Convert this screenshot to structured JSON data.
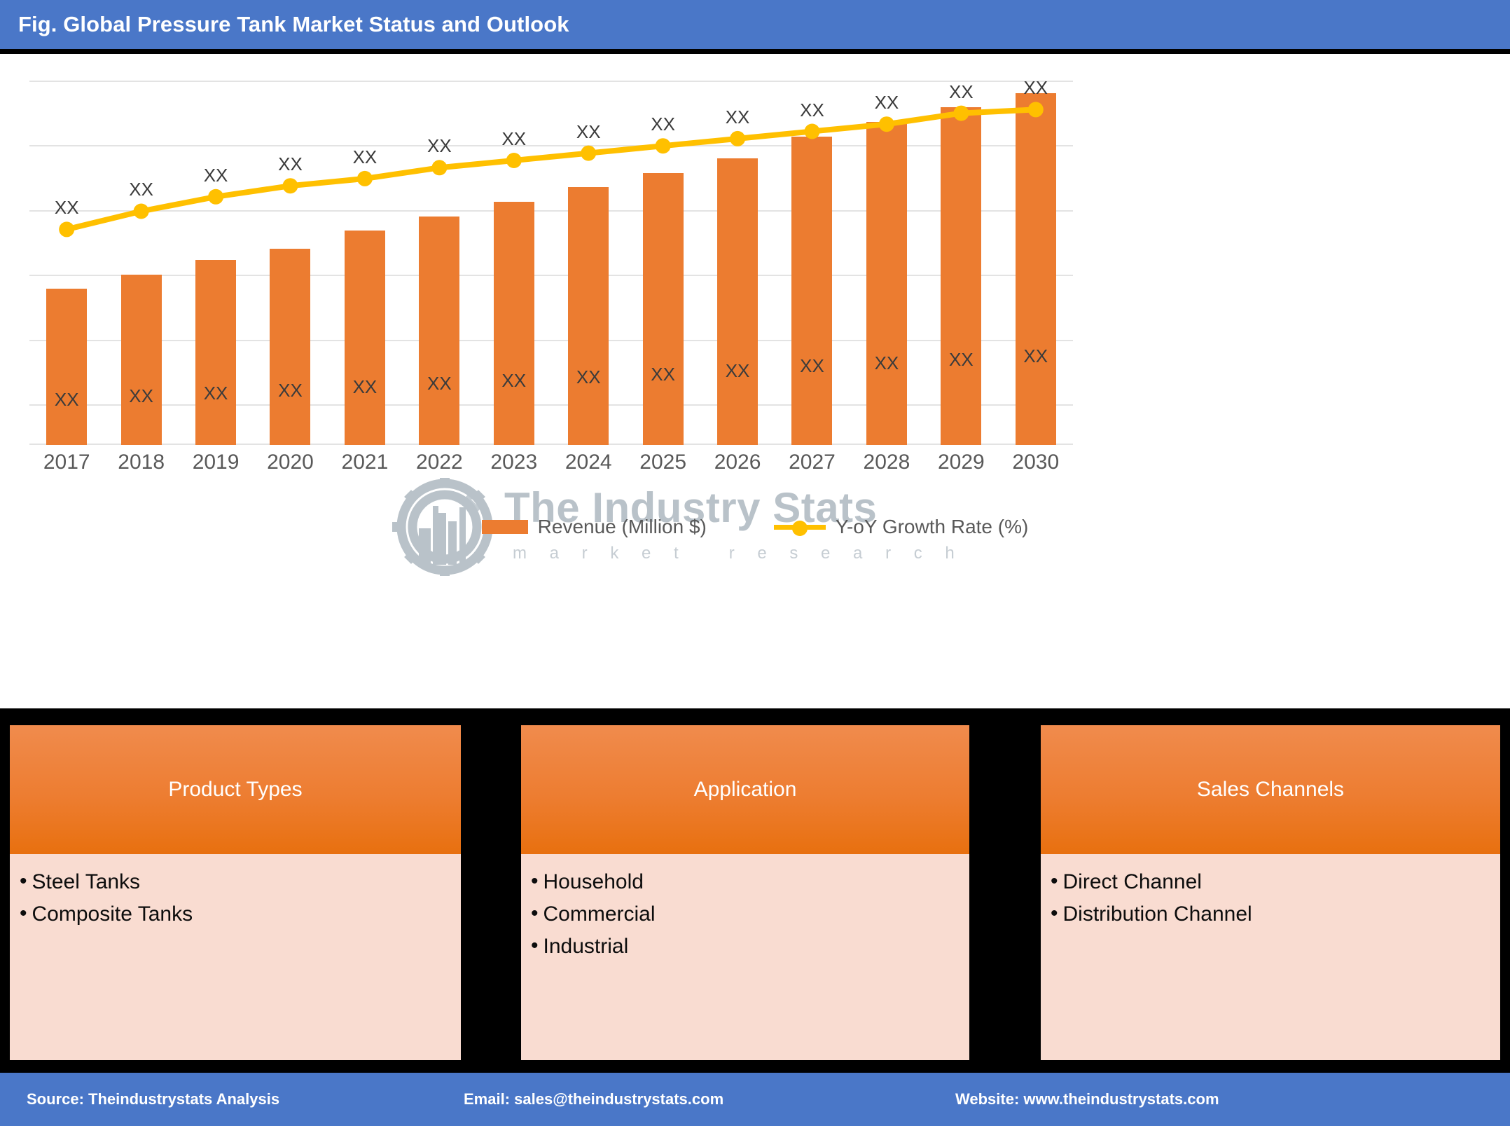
{
  "header": {
    "title": "Fig. Global Pressure Tank Market Status and Outlook",
    "bar_color": "#4a77c8"
  },
  "watermark": {
    "brand": "The Industry Stats",
    "tagline": "m a r k e t   r e s e a r c h",
    "logo_icon": "gear-wrench-factory-icon"
  },
  "chart_data": {
    "type": "bar",
    "title": "Fig. Global Pressure Tank Market Status and Outlook",
    "xlabel": "",
    "ylabel": "",
    "grid": true,
    "gridline_count": 6,
    "legend_position": "bottom",
    "categories": [
      "2017",
      "2018",
      "2019",
      "2020",
      "2021",
      "2022",
      "2023",
      "2024",
      "2025",
      "2026",
      "2027",
      "2028",
      "2029",
      "2030"
    ],
    "series": [
      {
        "name": "Revenue (Million $)",
        "type": "bar",
        "color": "#ec7c30",
        "axis": "left",
        "values": [
          43,
          47,
          51,
          54,
          59,
          63,
          67,
          71,
          75,
          79,
          85,
          89,
          93,
          97
        ],
        "data_labels": [
          "XX",
          "XX",
          "XX",
          "XX",
          "XX",
          "XX",
          "XX",
          "XX",
          "XX",
          "XX",
          "XX",
          "XX",
          "XX",
          "XX"
        ]
      },
      {
        "name": "Y-oY Growth Rate (%)",
        "type": "line",
        "color": "#ffc000",
        "marker": "circle",
        "axis": "right",
        "values": [
          59,
          64,
          68,
          71,
          73,
          76,
          78,
          80,
          82,
          84,
          86,
          88,
          91,
          92
        ],
        "data_labels": [
          "XX",
          "XX",
          "XX",
          "XX",
          "XX",
          "XX",
          "XX",
          "XX",
          "XX",
          "XX",
          "XX",
          "XX",
          "XX",
          "XX"
        ]
      }
    ]
  },
  "legend": [
    {
      "label": "Revenue (Million $)",
      "marker": "bar-swatch",
      "color": "#ec7c30"
    },
    {
      "label": "Y-oY Growth Rate (%)",
      "marker": "line-dot-swatch",
      "color": "#ffc000"
    }
  ],
  "segments": [
    {
      "heading": "Product Types",
      "items": [
        "Steel Tanks",
        "Composite Tanks"
      ]
    },
    {
      "heading": "Application",
      "items": [
        "Household",
        "Commercial",
        "Industrial"
      ]
    },
    {
      "heading": "Sales Channels",
      "items": [
        "Direct Channel",
        "Distribution Channel"
      ]
    }
  ],
  "footer": {
    "source": "Source: Theindustrystats Analysis",
    "email": "Email: sales@theindustrystats.com",
    "website": "Website: www.theindustrystats.com",
    "bar_color": "#4a77c8"
  }
}
